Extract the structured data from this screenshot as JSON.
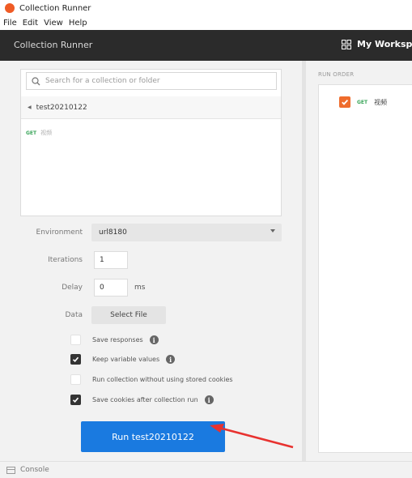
{
  "window": {
    "title": "Collection Runner"
  },
  "menu": [
    "File",
    "Edit",
    "View",
    "Help"
  ],
  "header": {
    "title": "Collection Runner",
    "workspace": "My Workspace"
  },
  "collection_panel": {
    "search_placeholder": "Search for a collection or folder",
    "collection_name": "test20210122",
    "request_method": "GET",
    "request_name": "视频"
  },
  "form": {
    "environment_label": "Environment",
    "environment_value": "url8180",
    "iterations_label": "Iterations",
    "iterations_value": "1",
    "delay_label": "Delay",
    "delay_value": "0",
    "delay_unit": "ms",
    "data_label": "Data",
    "select_file_label": "Select File"
  },
  "options": [
    {
      "label": "Save responses",
      "checked": false,
      "info": true
    },
    {
      "label": "Keep variable values",
      "checked": true,
      "info": true
    },
    {
      "label": "Run collection without using stored cookies",
      "checked": false,
      "info": false
    },
    {
      "label": "Save cookies after collection run",
      "checked": true,
      "info": true
    }
  ],
  "run_button": {
    "label": "Run test20210122"
  },
  "run_order": {
    "title": "RUN ORDER",
    "items": [
      {
        "method": "GET",
        "name": "视频",
        "checked": true
      }
    ]
  },
  "statusbar": {
    "console_label": "Console"
  },
  "colors": {
    "accent_blue": "#1a7ae0",
    "header_dark": "#2b2b2b",
    "checkbox_orange": "#ef6c2c",
    "get_green": "#3aa55a",
    "annotation_arrow": "#e8322f"
  }
}
